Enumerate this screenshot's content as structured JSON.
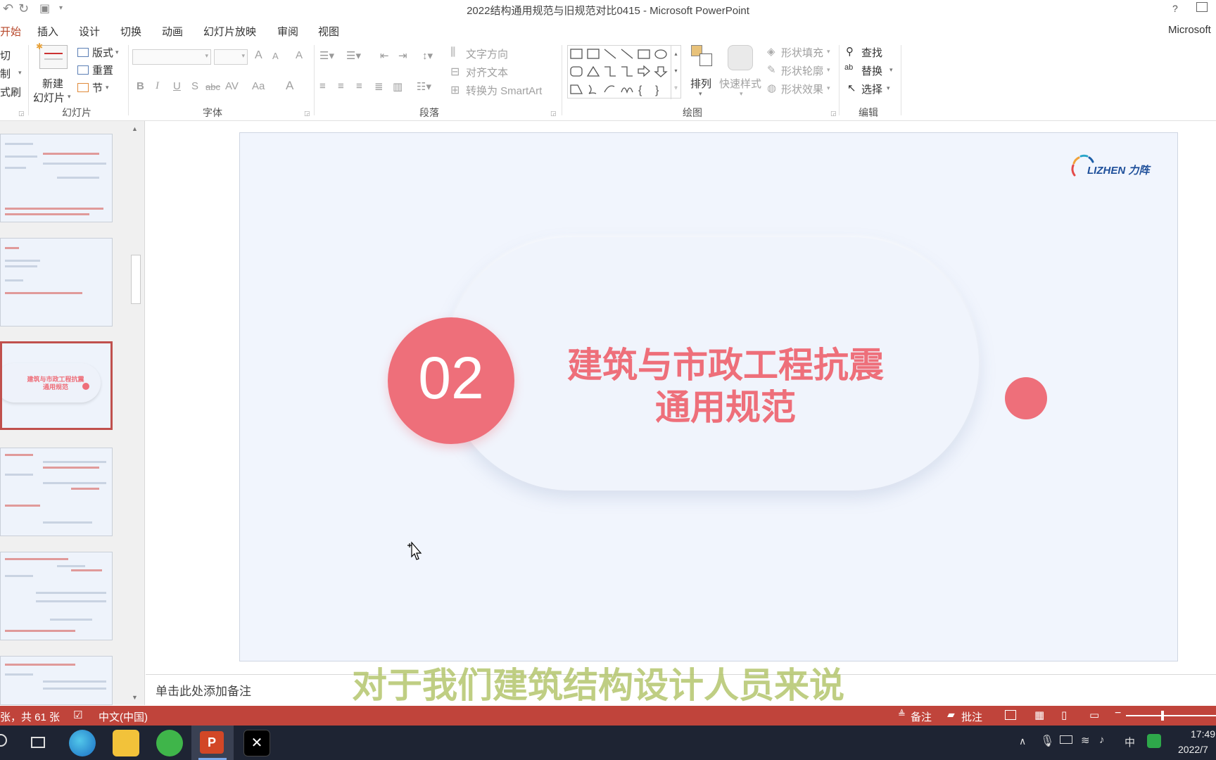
{
  "window": {
    "title": "2022结构通用规范与旧规范对比0415 - Microsoft PowerPoint",
    "help": "?",
    "account": "Microsoft"
  },
  "tabs": [
    "开始",
    "插入",
    "设计",
    "切换",
    "动画",
    "幻灯片放映",
    "审阅",
    "视图"
  ],
  "ribbon": {
    "clipboard": {
      "cut": "切",
      "copy": "制",
      "format_painter": "式刷"
    },
    "slides": {
      "new_slide_line1": "新建",
      "new_slide_line2": "幻灯片",
      "layout": "版式",
      "reset": "重置",
      "section": "节",
      "label": "幻灯片"
    },
    "font": {
      "label": "字体",
      "bold": "B",
      "italic": "I",
      "underline": "U",
      "shadow": "S",
      "strike": "abc",
      "grow": "A",
      "shrink": "A",
      "clear": "A",
      "case": "Aa",
      "spacing": "AV",
      "color": "A"
    },
    "paragraph": {
      "label": "段落",
      "text_direction": "文字方向",
      "align_text": "对齐文本",
      "smartart": "转换为 SmartArt"
    },
    "drawing": {
      "label": "绘图",
      "arrange": "排列",
      "quick_styles": "快速样式",
      "shape_fill": "形状填充",
      "shape_outline": "形状轮廓",
      "shape_effects": "形状效果"
    },
    "editing": {
      "label": "编辑",
      "find": "查找",
      "replace": "替换",
      "select": "选择"
    }
  },
  "slide": {
    "number": "02",
    "title_line1": "建筑与市政工程抗震",
    "title_line2": "通用规范",
    "logo_text": "LIZHEN 力阵",
    "accent": "#ee6f7a"
  },
  "thumbnails": {
    "selected_title_line1": "建筑与市政工程抗震",
    "selected_title_line2": "通用规范"
  },
  "notes_placeholder": "单击此处添加备注",
  "subtitle": "对于我们建筑结构设计人员来说",
  "status": {
    "slide_count": "张，共 61 张",
    "language": "中文(中国)",
    "notes": "备注",
    "comments": "批注"
  },
  "taskbar": {
    "time": "17:49",
    "date": "2022/7",
    "ime": "中"
  }
}
